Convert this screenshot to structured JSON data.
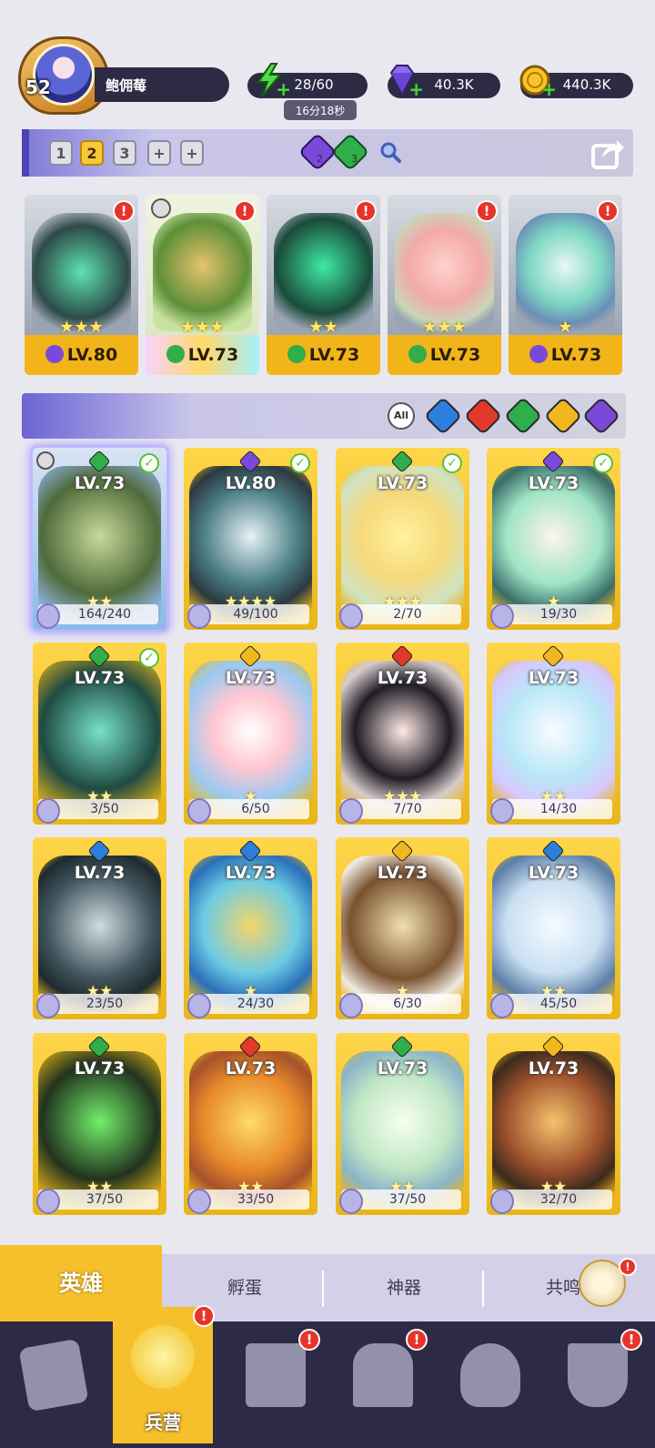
{
  "player": {
    "level": "52",
    "name": "鲍佣莓"
  },
  "resources": {
    "energy": "28/60",
    "energy_timer": "16分18秒",
    "gems": "40.3K",
    "gold": "440.3K"
  },
  "team_tabs": [
    "1",
    "2",
    "3",
    "+",
    "+"
  ],
  "team_element_counts": {
    "dark": "2",
    "nature": "3"
  },
  "team_heroes": [
    {
      "level": "LV.80",
      "element": "dark",
      "stars": "★★★"
    },
    {
      "level": "LV.73",
      "element": "nature",
      "stars": "★★★"
    },
    {
      "level": "LV.73",
      "element": "nature",
      "stars": "★★"
    },
    {
      "level": "LV.73",
      "element": "nature",
      "stars": "★★★"
    },
    {
      "level": "LV.73",
      "element": "dark",
      "stars": "★"
    }
  ],
  "filters": {
    "all_label": "All"
  },
  "heroes": [
    {
      "level": "LV.73",
      "fragments": "164/240",
      "element": "nature",
      "stars": "★★",
      "selected": true
    },
    {
      "level": "LV.80",
      "fragments": "49/100",
      "element": "dark",
      "stars": "★★★★"
    },
    {
      "level": "LV.73",
      "fragments": "2/70",
      "element": "nature",
      "stars": "★★★"
    },
    {
      "level": "LV.73",
      "fragments": "19/30",
      "element": "dark",
      "stars": "★"
    },
    {
      "level": "LV.73",
      "fragments": "3/50",
      "element": "nature",
      "stars": "★★"
    },
    {
      "level": "LV.73",
      "fragments": "6/50",
      "element": "light",
      "stars": "★"
    },
    {
      "level": "LV.73",
      "fragments": "7/70",
      "element": "fire",
      "stars": "★★★"
    },
    {
      "level": "LV.73",
      "fragments": "14/30",
      "element": "light",
      "stars": "★★"
    },
    {
      "level": "LV.73",
      "fragments": "23/50",
      "element": "water",
      "stars": "★★"
    },
    {
      "level": "LV.73",
      "fragments": "24/30",
      "element": "water",
      "stars": "★"
    },
    {
      "level": "LV.73",
      "fragments": "6/30",
      "element": "light",
      "stars": "★"
    },
    {
      "level": "LV.73",
      "fragments": "45/50",
      "element": "water",
      "stars": "★★"
    },
    {
      "level": "LV.73",
      "fragments": "37/50",
      "element": "nature",
      "stars": "★★"
    },
    {
      "level": "LV.73",
      "fragments": "33/50",
      "element": "fire",
      "stars": "★★"
    },
    {
      "level": "LV.73",
      "fragments": "37/50",
      "element": "nature",
      "stars": "★★"
    },
    {
      "level": "LV.73",
      "fragments": "32/70",
      "element": "light",
      "stars": "★★"
    }
  ],
  "tabs": [
    "英雄",
    "孵蛋",
    "神器",
    "共鸣"
  ],
  "bottom_nav": {
    "active_label": "兵营"
  },
  "colors": {
    "dark": "#7b49d9",
    "nature": "#2fae4a",
    "fire": "#e2392a",
    "water": "#2c7fdb",
    "light": "#f0b81d",
    "accent": "#f6c02b",
    "alert": "#e8332a"
  }
}
